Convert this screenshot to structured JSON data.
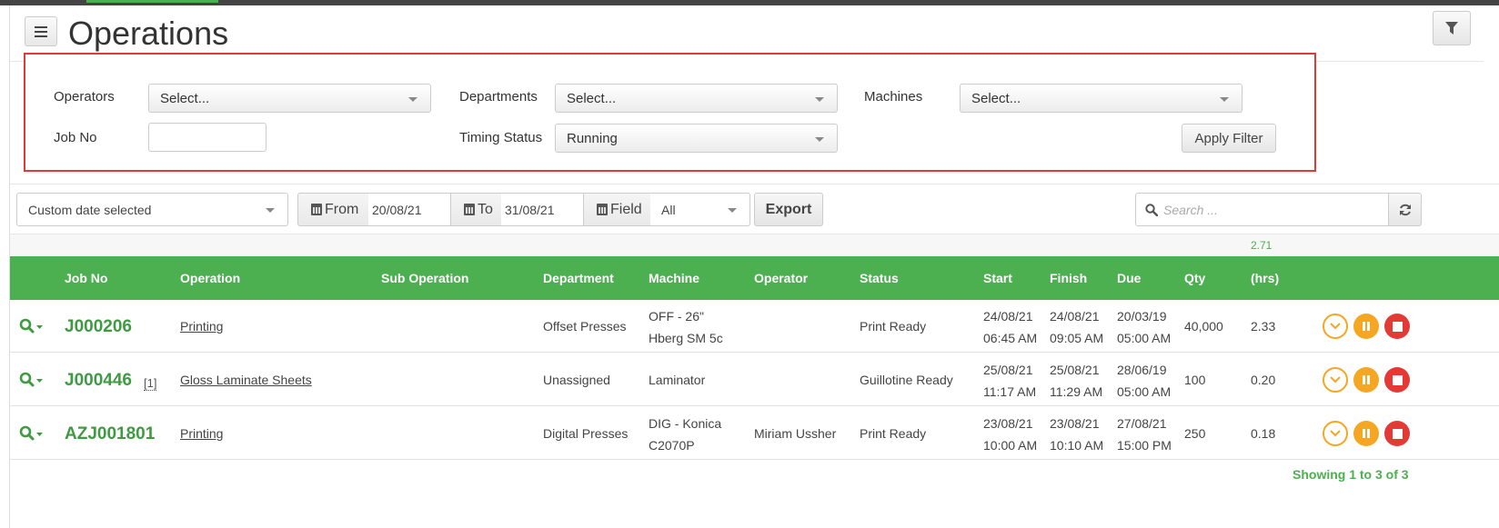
{
  "page": {
    "title": "Operations",
    "menu_icon": "hamburger-icon",
    "filter_icon": "filter-icon"
  },
  "filters": {
    "operators_label": "Operators",
    "operators_value": "Select...",
    "departments_label": "Departments",
    "departments_value": "Select...",
    "machines_label": "Machines",
    "machines_value": "Select...",
    "job_no_label": "Job No",
    "job_no_value": "",
    "timing_status_label": "Timing Status",
    "timing_status_value": "Running",
    "apply_label": "Apply Filter"
  },
  "toolbar": {
    "date_range": "Custom date selected",
    "from_label": "From",
    "from_value": "20/08/21",
    "to_label": "To",
    "to_value": "31/08/21",
    "field_label": "Field",
    "field_value": "All",
    "export_label": "Export",
    "search_placeholder": "Search ..."
  },
  "totals": {
    "hrs": "2.71"
  },
  "table": {
    "headers": {
      "job_no": "Job No",
      "operation": "Operation",
      "sub_operation": "Sub Operation",
      "department": "Department",
      "machine": "Machine",
      "operator": "Operator",
      "status": "Status",
      "start": "Start",
      "finish": "Finish",
      "due": "Due",
      "qty": "Qty",
      "hrs": "(hrs)"
    },
    "rows": [
      {
        "job_no": "J000206",
        "ref": "",
        "operation": "Printing",
        "sub_operation": "",
        "department": "Offset Presses",
        "machine_1": "OFF - 26\"",
        "machine_2": "Hberg SM 5c",
        "operator": "",
        "status": "Print Ready",
        "start_date": "24/08/21",
        "start_time": "06:45 AM",
        "finish_date": "24/08/21",
        "finish_time": "09:05 AM",
        "due_date": "20/03/19",
        "due_time": "05:00 AM",
        "qty": "40,000",
        "hrs": "2.33"
      },
      {
        "job_no": "J000446",
        "ref": "[1]",
        "operation": "Gloss Laminate Sheets",
        "sub_operation": "",
        "department": "Unassigned",
        "machine_1": "Laminator",
        "machine_2": "",
        "operator": "",
        "status": "Guillotine Ready",
        "start_date": "25/08/21",
        "start_time": "11:17 AM",
        "finish_date": "25/08/21",
        "finish_time": "11:29 AM",
        "due_date": "28/06/19",
        "due_time": "05:00 AM",
        "qty": "100",
        "hrs": "0.20"
      },
      {
        "job_no": "AZJ001801",
        "ref": "",
        "operation": "Printing",
        "sub_operation": "",
        "department": "Digital Presses",
        "machine_1": "DIG - Konica",
        "machine_2": "C2070P",
        "operator": "Miriam Ussher",
        "status": "Print Ready",
        "start_date": "23/08/21",
        "start_time": "10:00 AM",
        "finish_date": "23/08/21",
        "finish_time": "10:10 AM",
        "due_date": "27/08/21",
        "due_time": "15:00 PM",
        "qty": "250",
        "hrs": "0.18"
      }
    ]
  },
  "footer": {
    "info": "Showing 1 to 3 of 3"
  },
  "colors": {
    "accent": "#4caf50",
    "highlight_border": "#e53935",
    "action_orange": "#f5a623",
    "action_red": "#e53935"
  }
}
